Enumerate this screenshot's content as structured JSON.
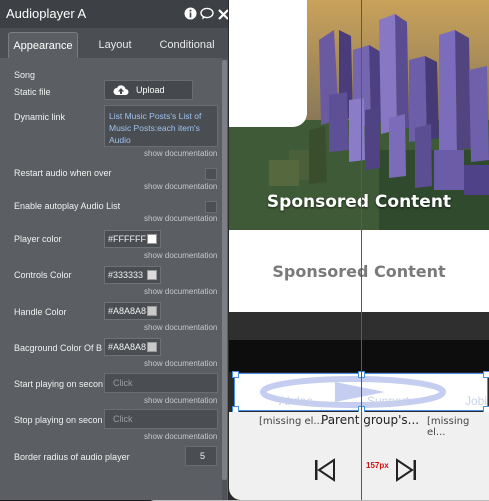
{
  "panel": {
    "title": "Audioplayer A",
    "tabs": [
      "Appearance",
      "Layout",
      "Conditional"
    ],
    "section_song": "Song",
    "static_file_label": "Static file",
    "upload_label": "Upload",
    "dynamic_link_label": "Dynamic link",
    "dynamic_link_value": "List Music Posts's List of Music Posts:each item's Audio",
    "show_doc": "show documentation",
    "restart_label": "Restart audio when over",
    "autoplay_label": "Enable autoplay Audio List",
    "player_color_label": "Player color",
    "player_color": "#FFFFFF",
    "controls_color_label": "Controls Color",
    "controls_color": "#333333",
    "handle_color_label": "Handle Color",
    "handle_color": "#A8A8A8",
    "bg_color_label": "Bacground Color Of B",
    "bg_color": "#A8A8A8",
    "start_label": "Start playing on secon",
    "start_placeholder": "Click",
    "stop_label": "Stop playing on secon",
    "stop_placeholder": "Click",
    "radius_label": "Border radius of audio player",
    "radius_value": "5"
  },
  "canvas": {
    "sponsored_1": "Sponsored Content",
    "sponsored_2": "Sponsored Content",
    "faint_left": "Al doe",
    "faint_right": "Support",
    "faint_far": "Jobi",
    "missing_left": "[missing el...",
    "parent_label": "Parent group's...",
    "missing_right": "[missing el...",
    "px_label": "157px"
  },
  "colors": {
    "panel_bg": "#5b5f63",
    "header_bg": "#3d4044",
    "guide_red": "#e02020",
    "selection_blue": "#4a90e2"
  }
}
